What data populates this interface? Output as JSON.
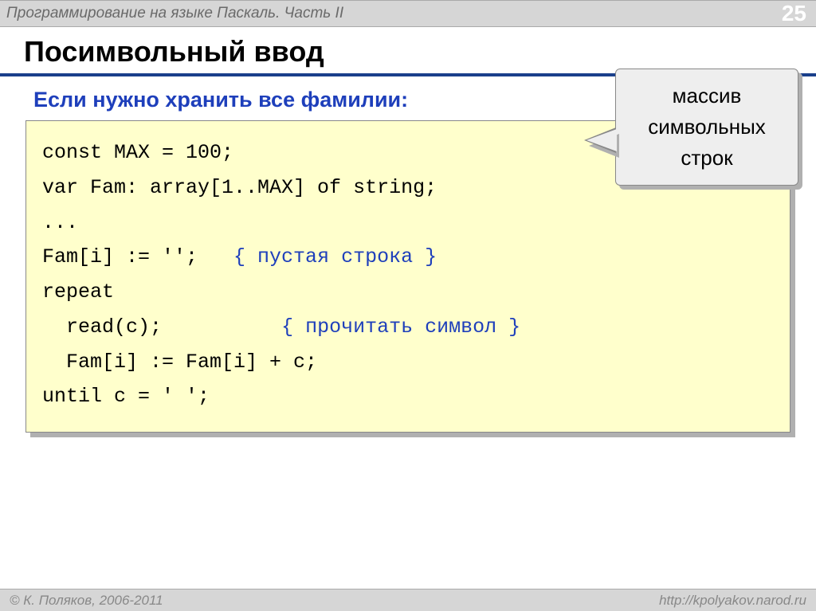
{
  "header": {
    "breadcrumb": "Программирование на языке Паскаль. Часть II",
    "page": "25"
  },
  "title": "Посимвольный ввод",
  "subtitle": "Если нужно хранить все фамилии:",
  "callout": {
    "line1": "массив",
    "line2": "символьных",
    "line3": "строк"
  },
  "code": {
    "l1": "const MAX = 100;",
    "l2": "var Fam: array[1..MAX] of string;",
    "l3": "...",
    "l4a": "Fam[i] := '';   ",
    "l4b": "{ пустая строка }",
    "l5": "repeat",
    "l6a": "  read(c);          ",
    "l6b": "{ прочитать символ }",
    "l7": "  Fam[i] := Fam[i] + c;",
    "l8": "until c = ' ';"
  },
  "footer": {
    "left": "© К. Поляков, 2006-2011",
    "right": "http://kpolyakov.narod.ru"
  }
}
